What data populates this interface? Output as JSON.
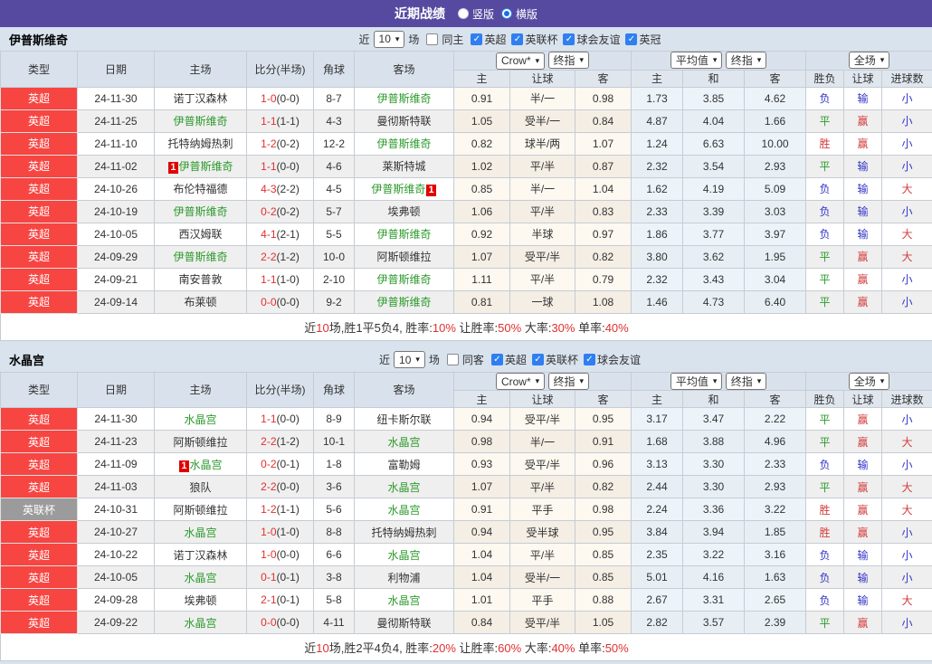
{
  "title_bar": {
    "title": "近期战绩",
    "options": [
      {
        "label": "竖版",
        "selected": false
      },
      {
        "label": "横版",
        "selected": true
      }
    ]
  },
  "colors": {
    "accent_purple": "#564aa0",
    "type_red": "#f74542",
    "type_gray": "#9b9b9b",
    "team_green": "#2c9a2c",
    "score_red": "#e03030",
    "win_red": "#d43c3c",
    "lose_blue": "#3434c8",
    "checkbox_blue": "#2f7ff0"
  },
  "result_color_map": {
    "胜": "red",
    "平": "green",
    "负": "blue",
    "赢": "red",
    "输": "blue",
    "大": "red",
    "小": "blue"
  },
  "table_header": {
    "left_cols": [
      "类型",
      "日期",
      "主场",
      "比分(半场)",
      "角球",
      "客场"
    ],
    "groups": [
      {
        "selects": [
          "Crow*",
          "终指"
        ],
        "cols": [
          "主",
          "让球",
          "客"
        ]
      },
      {
        "selects": [
          "平均值",
          "终指"
        ],
        "cols": [
          "主",
          "和",
          "客"
        ]
      },
      {
        "selects": [
          "全场"
        ],
        "cols": [
          "胜负",
          "让球",
          "进球数"
        ]
      }
    ]
  },
  "sections": [
    {
      "team": "伊普斯维奇",
      "filter": {
        "near_label": "近",
        "count": "10",
        "games_label": "场",
        "same_label": "同主",
        "same_checked": false,
        "leagues": [
          "英超",
          "英联杯",
          "球会友谊",
          "英冠"
        ]
      },
      "rows": [
        {
          "league": "英超",
          "league_gray": false,
          "date": "24-11-30",
          "home": "诺丁汉森林",
          "home_self": false,
          "home_badge": "",
          "score": "1-0",
          "half": "(0-0)",
          "corner": "8-7",
          "away": "伊普斯维奇",
          "away_self": true,
          "away_badge": "",
          "o1": "0.91",
          "o2": "半/一",
          "o3": "0.98",
          "a1": "1.73",
          "a2": "3.85",
          "a3": "4.62",
          "r1": "负",
          "r2": "输",
          "r3": "小"
        },
        {
          "league": "英超",
          "league_gray": false,
          "date": "24-11-25",
          "home": "伊普斯维奇",
          "home_self": true,
          "home_badge": "",
          "score": "1-1",
          "half": "(1-1)",
          "corner": "4-3",
          "away": "曼彻斯特联",
          "away_self": false,
          "away_badge": "",
          "o1": "1.05",
          "o2": "受半/一",
          "o3": "0.84",
          "a1": "4.87",
          "a2": "4.04",
          "a3": "1.66",
          "r1": "平",
          "r2": "赢",
          "r3": "小"
        },
        {
          "league": "英超",
          "league_gray": false,
          "date": "24-11-10",
          "home": "托特纳姆热刺",
          "home_self": false,
          "home_badge": "",
          "score": "1-2",
          "half": "(0-2)",
          "corner": "12-2",
          "away": "伊普斯维奇",
          "away_self": true,
          "away_badge": "",
          "o1": "0.82",
          "o2": "球半/两",
          "o3": "1.07",
          "a1": "1.24",
          "a2": "6.63",
          "a3": "10.00",
          "r1": "胜",
          "r2": "赢",
          "r3": "小"
        },
        {
          "league": "英超",
          "league_gray": false,
          "date": "24-11-02",
          "home": "伊普斯维奇",
          "home_self": true,
          "home_badge": "1",
          "score": "1-1",
          "half": "(0-0)",
          "corner": "4-6",
          "away": "莱斯特城",
          "away_self": false,
          "away_badge": "",
          "o1": "1.02",
          "o2": "平/半",
          "o3": "0.87",
          "a1": "2.32",
          "a2": "3.54",
          "a3": "2.93",
          "r1": "平",
          "r2": "输",
          "r3": "小"
        },
        {
          "league": "英超",
          "league_gray": false,
          "date": "24-10-26",
          "home": "布伦特福德",
          "home_self": false,
          "home_badge": "",
          "score": "4-3",
          "half": "(2-2)",
          "corner": "4-5",
          "away": "伊普斯维奇",
          "away_self": true,
          "away_badge": "1",
          "o1": "0.85",
          "o2": "半/一",
          "o3": "1.04",
          "a1": "1.62",
          "a2": "4.19",
          "a3": "5.09",
          "r1": "负",
          "r2": "输",
          "r3": "大"
        },
        {
          "league": "英超",
          "league_gray": false,
          "date": "24-10-19",
          "home": "伊普斯维奇",
          "home_self": true,
          "home_badge": "",
          "score": "0-2",
          "half": "(0-2)",
          "corner": "5-7",
          "away": "埃弗顿",
          "away_self": false,
          "away_badge": "",
          "o1": "1.06",
          "o2": "平/半",
          "o3": "0.83",
          "a1": "2.33",
          "a2": "3.39",
          "a3": "3.03",
          "r1": "负",
          "r2": "输",
          "r3": "小"
        },
        {
          "league": "英超",
          "league_gray": false,
          "date": "24-10-05",
          "home": "西汉姆联",
          "home_self": false,
          "home_badge": "",
          "score": "4-1",
          "half": "(2-1)",
          "corner": "5-5",
          "away": "伊普斯维奇",
          "away_self": true,
          "away_badge": "",
          "o1": "0.92",
          "o2": "半球",
          "o3": "0.97",
          "a1": "1.86",
          "a2": "3.77",
          "a3": "3.97",
          "r1": "负",
          "r2": "输",
          "r3": "大"
        },
        {
          "league": "英超",
          "league_gray": false,
          "date": "24-09-29",
          "home": "伊普斯维奇",
          "home_self": true,
          "home_badge": "",
          "score": "2-2",
          "half": "(1-2)",
          "corner": "10-0",
          "away": "阿斯顿维拉",
          "away_self": false,
          "away_badge": "",
          "o1": "1.07",
          "o2": "受平/半",
          "o3": "0.82",
          "a1": "3.80",
          "a2": "3.62",
          "a3": "1.95",
          "r1": "平",
          "r2": "赢",
          "r3": "大"
        },
        {
          "league": "英超",
          "league_gray": false,
          "date": "24-09-21",
          "home": "南安普敦",
          "home_self": false,
          "home_badge": "",
          "score": "1-1",
          "half": "(1-0)",
          "corner": "2-10",
          "away": "伊普斯维奇",
          "away_self": true,
          "away_badge": "",
          "o1": "1.11",
          "o2": "平/半",
          "o3": "0.79",
          "a1": "2.32",
          "a2": "3.43",
          "a3": "3.04",
          "r1": "平",
          "r2": "赢",
          "r3": "小"
        },
        {
          "league": "英超",
          "league_gray": false,
          "date": "24-09-14",
          "home": "布莱顿",
          "home_self": false,
          "home_badge": "",
          "score": "0-0",
          "half": "(0-0)",
          "corner": "9-2",
          "away": "伊普斯维奇",
          "away_self": true,
          "away_badge": "",
          "o1": "0.81",
          "o2": "一球",
          "o3": "1.08",
          "a1": "1.46",
          "a2": "4.73",
          "a3": "6.40",
          "r1": "平",
          "r2": "赢",
          "r3": "小"
        }
      ],
      "summary": [
        [
          "近",
          "d"
        ],
        [
          "10",
          "r"
        ],
        [
          "场,胜1平5负4, 胜率:",
          "d"
        ],
        [
          "10%",
          "r"
        ],
        [
          " 让胜率:",
          "d"
        ],
        [
          "50%",
          "r"
        ],
        [
          " 大率:",
          "d"
        ],
        [
          "30%",
          "r"
        ],
        [
          " 单率:",
          "d"
        ],
        [
          "40%",
          "r"
        ]
      ]
    },
    {
      "team": "水晶宫",
      "filter": {
        "near_label": "近",
        "count": "10",
        "games_label": "场",
        "same_label": "同客",
        "same_checked": false,
        "leagues": [
          "英超",
          "英联杯",
          "球会友谊"
        ]
      },
      "rows": [
        {
          "league": "英超",
          "league_gray": false,
          "date": "24-11-30",
          "home": "水晶宫",
          "home_self": true,
          "home_badge": "",
          "score": "1-1",
          "half": "(0-0)",
          "corner": "8-9",
          "away": "纽卡斯尔联",
          "away_self": false,
          "away_badge": "",
          "o1": "0.94",
          "o2": "受平/半",
          "o3": "0.95",
          "a1": "3.17",
          "a2": "3.47",
          "a3": "2.22",
          "r1": "平",
          "r2": "赢",
          "r3": "小"
        },
        {
          "league": "英超",
          "league_gray": false,
          "date": "24-11-23",
          "home": "阿斯顿维拉",
          "home_self": false,
          "home_badge": "",
          "score": "2-2",
          "half": "(1-2)",
          "corner": "10-1",
          "away": "水晶宫",
          "away_self": true,
          "away_badge": "",
          "o1": "0.98",
          "o2": "半/一",
          "o3": "0.91",
          "a1": "1.68",
          "a2": "3.88",
          "a3": "4.96",
          "r1": "平",
          "r2": "赢",
          "r3": "大"
        },
        {
          "league": "英超",
          "league_gray": false,
          "date": "24-11-09",
          "home": "水晶宫",
          "home_self": true,
          "home_badge": "1",
          "score": "0-2",
          "half": "(0-1)",
          "corner": "1-8",
          "away": "富勒姆",
          "away_self": false,
          "away_badge": "",
          "o1": "0.93",
          "o2": "受平/半",
          "o3": "0.96",
          "a1": "3.13",
          "a2": "3.30",
          "a3": "2.33",
          "r1": "负",
          "r2": "输",
          "r3": "小"
        },
        {
          "league": "英超",
          "league_gray": false,
          "date": "24-11-03",
          "home": "狼队",
          "home_self": false,
          "home_badge": "",
          "score": "2-2",
          "half": "(0-0)",
          "corner": "3-6",
          "away": "水晶宫",
          "away_self": true,
          "away_badge": "",
          "o1": "1.07",
          "o2": "平/半",
          "o3": "0.82",
          "a1": "2.44",
          "a2": "3.30",
          "a3": "2.93",
          "r1": "平",
          "r2": "赢",
          "r3": "大"
        },
        {
          "league": "英联杯",
          "league_gray": true,
          "date": "24-10-31",
          "home": "阿斯顿维拉",
          "home_self": false,
          "home_badge": "",
          "score": "1-2",
          "half": "(1-1)",
          "corner": "5-6",
          "away": "水晶宫",
          "away_self": true,
          "away_badge": "",
          "o1": "0.91",
          "o2": "平手",
          "o3": "0.98",
          "a1": "2.24",
          "a2": "3.36",
          "a3": "3.22",
          "r1": "胜",
          "r2": "赢",
          "r3": "大"
        },
        {
          "league": "英超",
          "league_gray": false,
          "date": "24-10-27",
          "home": "水晶宫",
          "home_self": true,
          "home_badge": "",
          "score": "1-0",
          "half": "(1-0)",
          "corner": "8-8",
          "away": "托特纳姆热刺",
          "away_self": false,
          "away_badge": "",
          "o1": "0.94",
          "o2": "受半球",
          "o3": "0.95",
          "a1": "3.84",
          "a2": "3.94",
          "a3": "1.85",
          "r1": "胜",
          "r2": "赢",
          "r3": "小"
        },
        {
          "league": "英超",
          "league_gray": false,
          "date": "24-10-22",
          "home": "诺丁汉森林",
          "home_self": false,
          "home_badge": "",
          "score": "1-0",
          "half": "(0-0)",
          "corner": "6-6",
          "away": "水晶宫",
          "away_self": true,
          "away_badge": "",
          "o1": "1.04",
          "o2": "平/半",
          "o3": "0.85",
          "a1": "2.35",
          "a2": "3.22",
          "a3": "3.16",
          "r1": "负",
          "r2": "输",
          "r3": "小"
        },
        {
          "league": "英超",
          "league_gray": false,
          "date": "24-10-05",
          "home": "水晶宫",
          "home_self": true,
          "home_badge": "",
          "score": "0-1",
          "half": "(0-1)",
          "corner": "3-8",
          "away": "利物浦",
          "away_self": false,
          "away_badge": "",
          "o1": "1.04",
          "o2": "受半/一",
          "o3": "0.85",
          "a1": "5.01",
          "a2": "4.16",
          "a3": "1.63",
          "r1": "负",
          "r2": "输",
          "r3": "小"
        },
        {
          "league": "英超",
          "league_gray": false,
          "date": "24-09-28",
          "home": "埃弗顿",
          "home_self": false,
          "home_badge": "",
          "score": "2-1",
          "half": "(0-1)",
          "corner": "5-8",
          "away": "水晶宫",
          "away_self": true,
          "away_badge": "",
          "o1": "1.01",
          "o2": "平手",
          "o3": "0.88",
          "a1": "2.67",
          "a2": "3.31",
          "a3": "2.65",
          "r1": "负",
          "r2": "输",
          "r3": "大"
        },
        {
          "league": "英超",
          "league_gray": false,
          "date": "24-09-22",
          "home": "水晶宫",
          "home_self": true,
          "home_badge": "",
          "score": "0-0",
          "half": "(0-0)",
          "corner": "4-11",
          "away": "曼彻斯特联",
          "away_self": false,
          "away_badge": "",
          "o1": "0.84",
          "o2": "受平/半",
          "o3": "1.05",
          "a1": "2.82",
          "a2": "3.57",
          "a3": "2.39",
          "r1": "平",
          "r2": "赢",
          "r3": "小"
        }
      ],
      "summary": [
        [
          "近",
          "d"
        ],
        [
          "10",
          "r"
        ],
        [
          "场,胜2平4负4, 胜率:",
          "d"
        ],
        [
          "20%",
          "r"
        ],
        [
          " 让胜率:",
          "d"
        ],
        [
          "60%",
          "r"
        ],
        [
          " 大率:",
          "d"
        ],
        [
          "40%",
          "r"
        ],
        [
          " 单率:",
          "d"
        ],
        [
          "50%",
          "r"
        ]
      ]
    }
  ]
}
